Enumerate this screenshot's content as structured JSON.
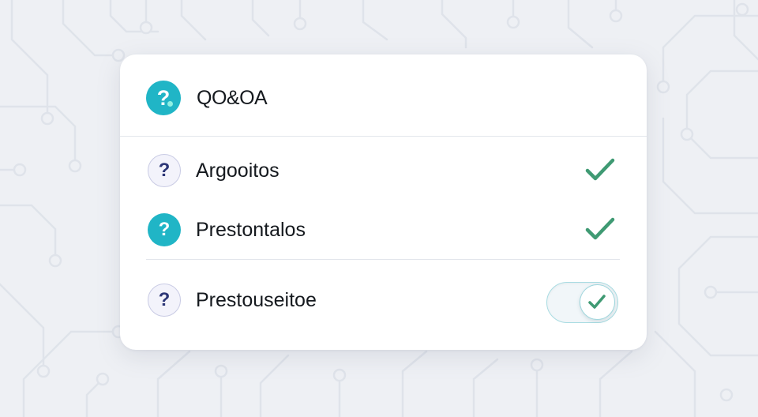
{
  "header": {
    "icon": "question-mark-icon",
    "title": "QO&OA"
  },
  "items": [
    {
      "icon": "question-mark-icon",
      "icon_style": "outline",
      "label": "Argooitos",
      "status": "checkmark-icon"
    },
    {
      "icon": "question-mark-icon",
      "icon_style": "filled",
      "label": "Prestontalos",
      "status": "checkmark-icon"
    },
    {
      "icon": "question-mark-icon",
      "icon_style": "outline",
      "label": "Prestouseitoe",
      "status": "toggle",
      "toggle_on": true
    }
  ],
  "glyphs": {
    "question": "?"
  },
  "colors": {
    "accent_teal": "#20b5c6",
    "check_green": "#3f9a73",
    "icon_outline_glyph": "#2c3676",
    "background": "#eef0f4",
    "card": "#ffffff"
  }
}
